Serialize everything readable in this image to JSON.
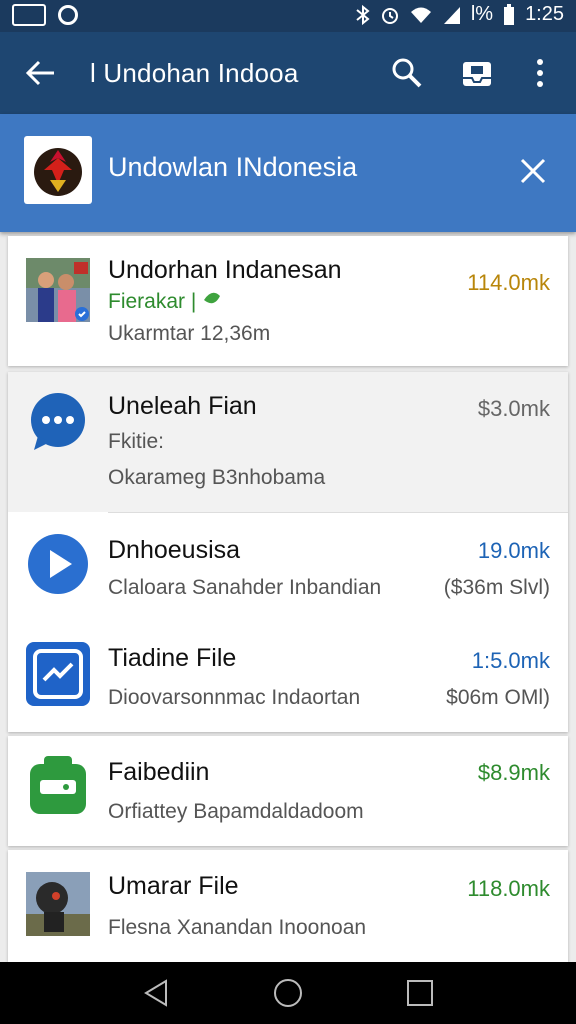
{
  "status_bar": {
    "time": "1:25",
    "battery_text": "l%",
    "icons": [
      "bluetooth-icon",
      "alarm-icon",
      "wifi-icon",
      "signal-icon",
      "battery-icon"
    ]
  },
  "toolbar": {
    "title": "l Undohan Indooa",
    "icons": [
      "back-arrow-icon",
      "search-icon",
      "inbox-icon",
      "more-vert-icon"
    ]
  },
  "banner": {
    "title": "Undowlan INdonesia",
    "close_icon": "close-icon"
  },
  "items": [
    {
      "title": "Undorhan Indanesan",
      "subtitle": "Fierakar |",
      "subtitle_color": "#2e8b2e",
      "meta": "Ukarmtar 12,36m",
      "price": "114.0mk",
      "price_color": "#b8860b",
      "icon": "profile-photo-icon"
    },
    {
      "title": "Uneleah Fian",
      "subtitle": "Fkitie:",
      "meta": "Okarameg B3nhobama",
      "price": "$3.0mk",
      "price_color": "#666666",
      "icon": "chat-bubble-icon"
    },
    {
      "title": "Dnhoeusisa",
      "subtitle": "Claloara Sanahder Inbandian",
      "extra": "($36m Slvl)",
      "price": "19.0mk",
      "price_color": "#1d63b5",
      "icon": "play-icon"
    },
    {
      "title": "Tiadine File",
      "subtitle": "Dioovarsonnmac Indaortan",
      "extra": "$06m OMl)",
      "price": "1:5.0mk",
      "price_color": "#1d63b5",
      "icon": "messenger-icon"
    },
    {
      "title": "Faibediin",
      "subtitle": "Orfiattey Bapamdaldadoom",
      "price": "$8.9mk",
      "price_color": "#2e8b2e",
      "icon": "green-robot-icon"
    },
    {
      "title": "Umarar File",
      "subtitle": "Flesna Xanandan Inoonoan",
      "price": "118.0mk",
      "price_color": "#2e8b2e",
      "icon": "avatar-photo-icon"
    }
  ],
  "nav_bar": {
    "icons": [
      "back-triangle-icon",
      "home-circle-icon",
      "recents-square-icon"
    ]
  }
}
